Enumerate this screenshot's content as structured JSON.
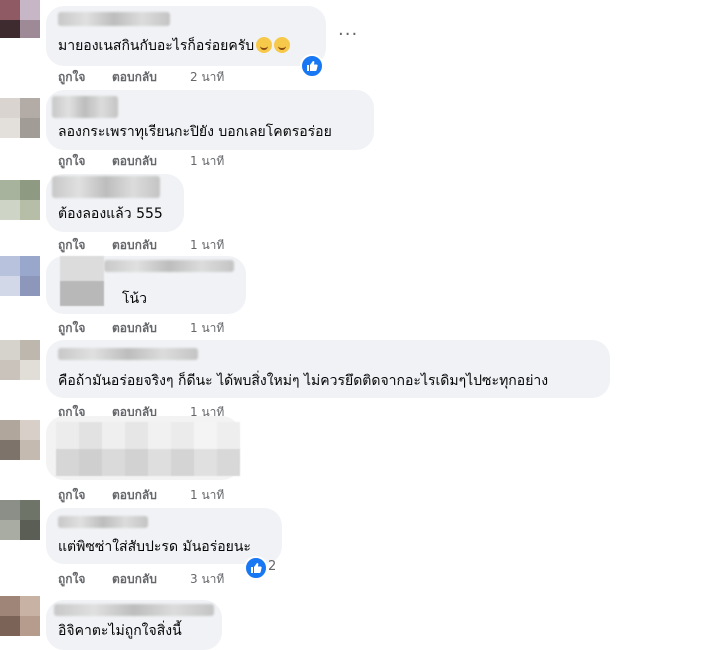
{
  "actions": {
    "like": "ถูกใจ",
    "reply": "ตอบกลับ"
  },
  "icons": {
    "more": "more-options-icon",
    "like_badge": "like-reaction-icon",
    "emoji": "grinning-face-icon"
  },
  "colors": {
    "bubble": "#f0f2f5",
    "like_blue": "#1877f2",
    "meta_gray": "#65676b"
  },
  "comments": [
    {
      "text": "มายองเนสกินกับอะไรก็อร่อยครับ",
      "time": "2 นาที",
      "reaction_count": ""
    },
    {
      "text": "ลองกระเพราทุเรียนกะปิยัง บอกเลยโคตรอร่อย",
      "time": "1 นาที",
      "reaction_count": ""
    },
    {
      "text": "ต้องลองแล้ว 555",
      "time": "1 นาที",
      "reaction_count": ""
    },
    {
      "text": "โน้ว",
      "time": "1 นาที",
      "reaction_count": ""
    },
    {
      "text": "คือถ้ามันอร่อยจริงๆ ก็ดีนะ ได้พบสิ่งใหม่ๆ ไม่ควรยึดติดจากอะไรเดิมๆไปซะทุกอย่าง",
      "time": "1 นาที",
      "reaction_count": ""
    },
    {
      "text": "",
      "time": "1 นาที",
      "reaction_count": ""
    },
    {
      "text": "แต่พิซซ่าใส่สับปะรด มันอร่อยนะ",
      "time": "3 นาที",
      "reaction_count": "2"
    },
    {
      "text": "อิจิคาตะไม่ถูกใจสิ่งนี้",
      "time": "",
      "reaction_count": ""
    }
  ]
}
